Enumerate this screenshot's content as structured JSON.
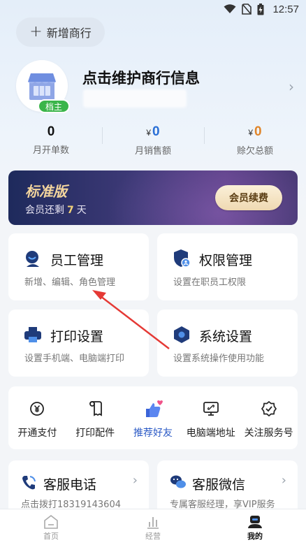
{
  "status_bar": {
    "time": "12:57"
  },
  "header": {
    "add_shop_label": "新增商行"
  },
  "profile": {
    "title": "点击维护商行信息",
    "owner_badge": "档主"
  },
  "stats": [
    {
      "value": "0",
      "currency": "",
      "label": "月开单数",
      "color": "#111111"
    },
    {
      "value": "0",
      "currency": "¥",
      "label": "月销售额",
      "color": "#2a6fd6"
    },
    {
      "value": "0",
      "currency": "¥",
      "label": "赊欠总额",
      "color": "#e0852a"
    }
  ],
  "membership": {
    "tier": "标准版",
    "remain_prefix": "会员还剩",
    "remain_days": "7",
    "remain_suffix": "天",
    "renew_label": "会员续费"
  },
  "cards": {
    "staff": {
      "title": "员工管理",
      "desc": "新增、编辑、角色管理",
      "icon": "staff-icon"
    },
    "permission": {
      "title": "权限管理",
      "desc": "设置在职员工权限",
      "icon": "shield-user-icon"
    },
    "print": {
      "title": "打印设置",
      "desc": "设置手机端、电脑端打印",
      "icon": "printer-icon"
    },
    "system": {
      "title": "系统设置",
      "desc": "设置系统操作使用功能",
      "icon": "hexagon-gear-icon"
    }
  },
  "quick_actions": [
    {
      "label": "开通支付",
      "icon": "payment-icon"
    },
    {
      "label": "打印配件",
      "icon": "paper-roll-icon"
    },
    {
      "label": "推荐好友",
      "icon": "thumb-heart-icon",
      "active": true
    },
    {
      "label": "电脑端地址",
      "icon": "monitor-link-icon"
    },
    {
      "label": "关注服务号",
      "icon": "verified-badge-icon"
    }
  ],
  "service": {
    "phone": {
      "title": "客服电话",
      "desc": "点击拨打18319143604"
    },
    "wechat": {
      "title": "客服微信",
      "desc": "专属客服经理，享VIP服务"
    }
  },
  "tabbar": [
    {
      "label": "首页",
      "icon": "home-icon"
    },
    {
      "label": "经营",
      "icon": "bar-chart-icon"
    },
    {
      "label": "我的",
      "icon": "profile-icon",
      "active": true
    }
  ],
  "colors": {
    "accent_blue": "#2a59c5",
    "owner_green": "#3bb54a",
    "member_gold": "#f3d59d",
    "annotation_red": "#e53935"
  }
}
